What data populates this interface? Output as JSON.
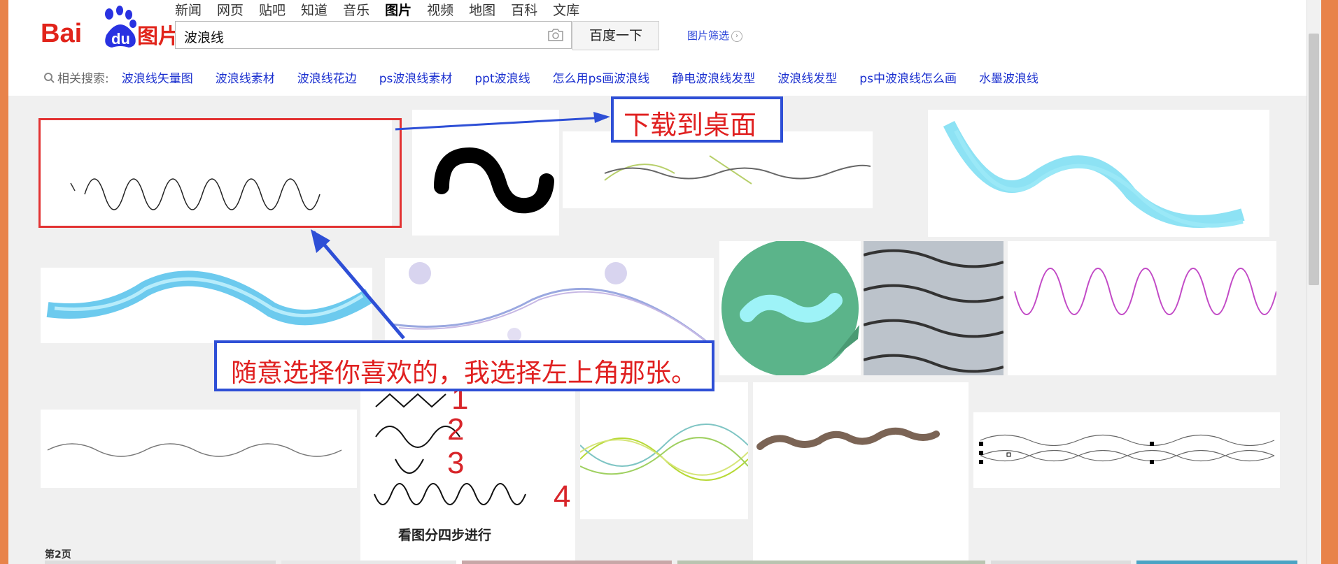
{
  "logo": {
    "bai": "Bai",
    "du": "du",
    "tupian": "图片"
  },
  "nav": {
    "items": [
      "新闻",
      "网页",
      "贴吧",
      "知道",
      "音乐",
      "图片",
      "视频",
      "地图",
      "百科",
      "文库"
    ],
    "active": "图片"
  },
  "search": {
    "query": "波浪线",
    "button_label": "百度一下",
    "camera_icon": "camera-icon"
  },
  "filter": {
    "label": "图片筛选"
  },
  "related": {
    "label": "相关搜索:",
    "items": [
      "波浪线矢量图",
      "波浪线素材",
      "波浪线花边",
      "ps波浪线素材",
      "ppt波浪线",
      "怎么用ps画波浪线",
      "静电波浪线发型",
      "波浪线发型",
      "ps中波浪线怎么画",
      "水墨波浪线"
    ]
  },
  "tiles": {
    "steps_caption": "看图分四步进行",
    "step_numbers": [
      "1",
      "2",
      "3",
      "4"
    ]
  },
  "pagination": {
    "label": "第2页"
  },
  "annotations": {
    "download": "下载到桌面",
    "choose": "随意选择你喜欢的，我选择左上角那张。"
  },
  "colors": {
    "baidu_red": "#e1241b",
    "baidu_blue": "#2932e1",
    "annotation_blue": "#2e4fd6",
    "annotation_red": "#e02020",
    "link_blue": "#1a2fcf"
  }
}
